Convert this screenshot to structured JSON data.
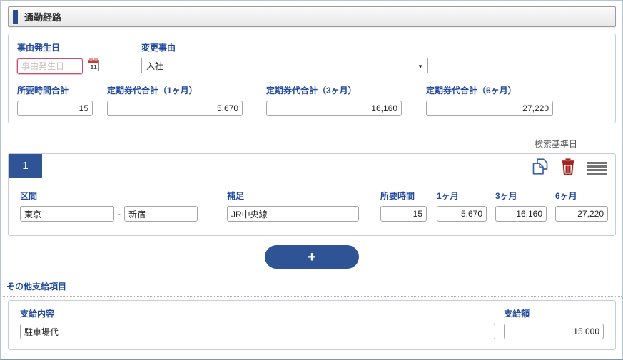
{
  "page": {
    "title": "通勤経路"
  },
  "colors": {
    "accent_blue": "#2e5496",
    "label_blue": "#20489f",
    "required_pink": "#d04a70",
    "danger_red": "#a32420"
  },
  "summary": {
    "reason_date": {
      "label": "事由発生日",
      "placeholder": "事由発生日",
      "value": ""
    },
    "calendar_day": "31",
    "change_reason": {
      "label": "変更事由",
      "value": "入社"
    },
    "time_total": {
      "label": "所要時間合計",
      "value": "15"
    },
    "pass_1m": {
      "label": "定期券代合計（1ヶ月）",
      "value": "5,670"
    },
    "pass_3m": {
      "label": "定期券代合計（3ヶ月）",
      "value": "16,160"
    },
    "pass_6m": {
      "label": "定期券代合計（6ヶ月）",
      "value": "27,220"
    }
  },
  "search_base_date_label": "検索基準日",
  "route": {
    "index": "1",
    "section": {
      "label": "区間",
      "from": "東京",
      "separator": "-",
      "to": "新宿"
    },
    "note": {
      "label": "補足",
      "value": "JR中央線"
    },
    "time": {
      "label": "所要時間",
      "value": "15"
    },
    "m1": {
      "label": "1ヶ月",
      "value": "5,670"
    },
    "m3": {
      "label": "3ヶ月",
      "value": "16,160"
    },
    "m6": {
      "label": "6ヶ月",
      "value": "27,220"
    }
  },
  "add_button_label": "+",
  "other": {
    "section_title": "その他支給項目",
    "content": {
      "label": "支給内容",
      "value": "駐車場代"
    },
    "amount": {
      "label": "支給額",
      "value": "15,000"
    }
  }
}
